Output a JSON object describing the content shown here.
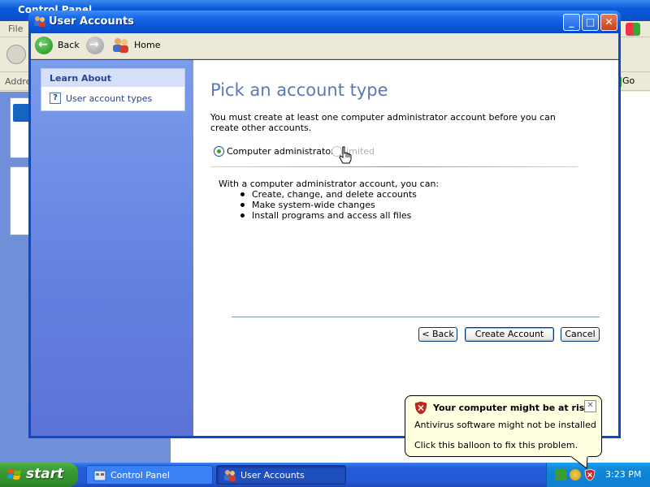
{
  "background_window": {
    "title": "Control Panel",
    "menu_file": "File",
    "address_label": "Addre",
    "go_label": "Go"
  },
  "window": {
    "title": "User Accounts",
    "minimize_glyph": "_",
    "maximize_glyph": "□",
    "close_glyph": "✕"
  },
  "toolbar": {
    "back_label": "Back",
    "home_label": "Home",
    "back_arrow": "←",
    "forward_arrow": "→"
  },
  "sidebar": {
    "learn_about": {
      "title": "Learn About",
      "items": [
        {
          "label": "User account types",
          "icon": "help-icon",
          "icon_glyph": "?"
        }
      ]
    }
  },
  "main": {
    "heading": "Pick an account type",
    "description": "You must create at least one computer administrator account before you can create other accounts.",
    "account_types": [
      {
        "label": "Computer administrator",
        "selected": true,
        "enabled": true
      },
      {
        "label": "Limited",
        "selected": false,
        "enabled": false
      }
    ],
    "admin_intro": "With a computer administrator account, you can:",
    "admin_capabilities": [
      "Create, change, and delete accounts",
      "Make system-wide changes",
      "Install programs and access all files"
    ]
  },
  "buttons": {
    "back": "< Back",
    "create": "Create Account",
    "cancel": "Cancel"
  },
  "taskbar": {
    "start": "start",
    "tasks": [
      {
        "label": "Control Panel",
        "active": false
      },
      {
        "label": "User Accounts",
        "active": true
      }
    ],
    "clock": "3:23 PM"
  },
  "balloon": {
    "title": "Your computer might be at risk",
    "line1": "Antivirus software might not be installed",
    "line2": "Click this balloon to fix this problem.",
    "close_glyph": "✕"
  },
  "colors": {
    "titlebar": "#0a55d8",
    "sidebar": "#6380df",
    "heading": "#5a78b8",
    "start_green": "#3c9c36",
    "balloon_bg": "#ffffe1"
  }
}
